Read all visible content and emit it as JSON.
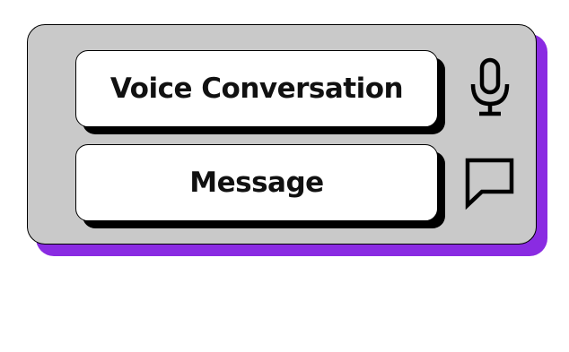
{
  "colors": {
    "panel_background": "#c9c9c9",
    "panel_shadow": "#8a2be2",
    "button_background": "#ffffff",
    "outline": "#000000"
  },
  "options": [
    {
      "label": "Voice Conversation",
      "icon": "microphone-icon"
    },
    {
      "label": "Message",
      "icon": "chat-bubble-icon"
    }
  ]
}
